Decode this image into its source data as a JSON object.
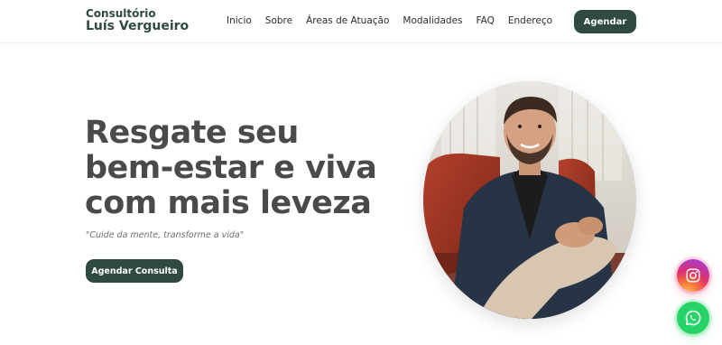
{
  "header": {
    "logo_line1": "Consultório",
    "logo_line2": "Luís Vergueiro",
    "nav": [
      "Inicio",
      "Sobre",
      "Áreas de Atuação",
      "Modalidades",
      "FAQ",
      "Endereço"
    ],
    "cta_label": "Agendar"
  },
  "hero": {
    "title_lines": [
      "Resgate seu",
      "bem-estar e viva",
      "com mais leveza"
    ],
    "tagline": "\"Cuide da mente, transforme a vida\"",
    "cta_label": "Agendar Consulta"
  },
  "floating": {
    "instagram_icon": "instagram-icon",
    "whatsapp_icon": "whatsapp-icon"
  },
  "colors": {
    "brand": "#2f4a3e",
    "heading": "#4a4a4a",
    "whatsapp": "#25d366"
  }
}
